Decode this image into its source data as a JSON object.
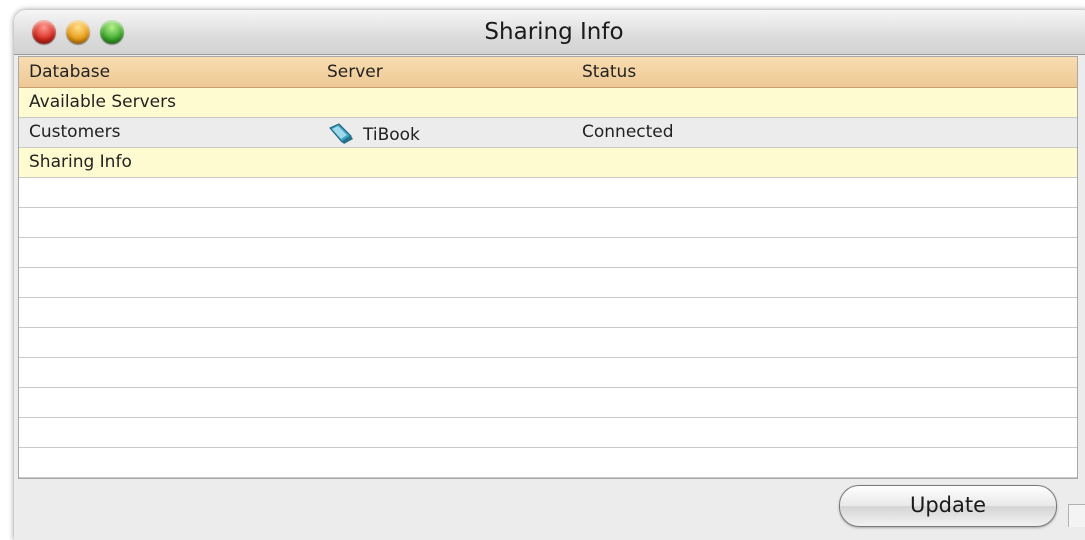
{
  "window": {
    "title": "Sharing Info"
  },
  "table": {
    "columns": [
      "Database",
      "Server",
      "Status"
    ],
    "rows": [
      {
        "type": "group",
        "database": "Available Servers",
        "server": "",
        "status": ""
      },
      {
        "type": "data",
        "database": "Customers",
        "server": "TiBook",
        "server_icon": "laptop-server-icon",
        "status": "Connected"
      },
      {
        "type": "group",
        "database": "Sharing Info",
        "server": "",
        "status": ""
      }
    ]
  },
  "footer": {
    "update_label": "Update"
  }
}
